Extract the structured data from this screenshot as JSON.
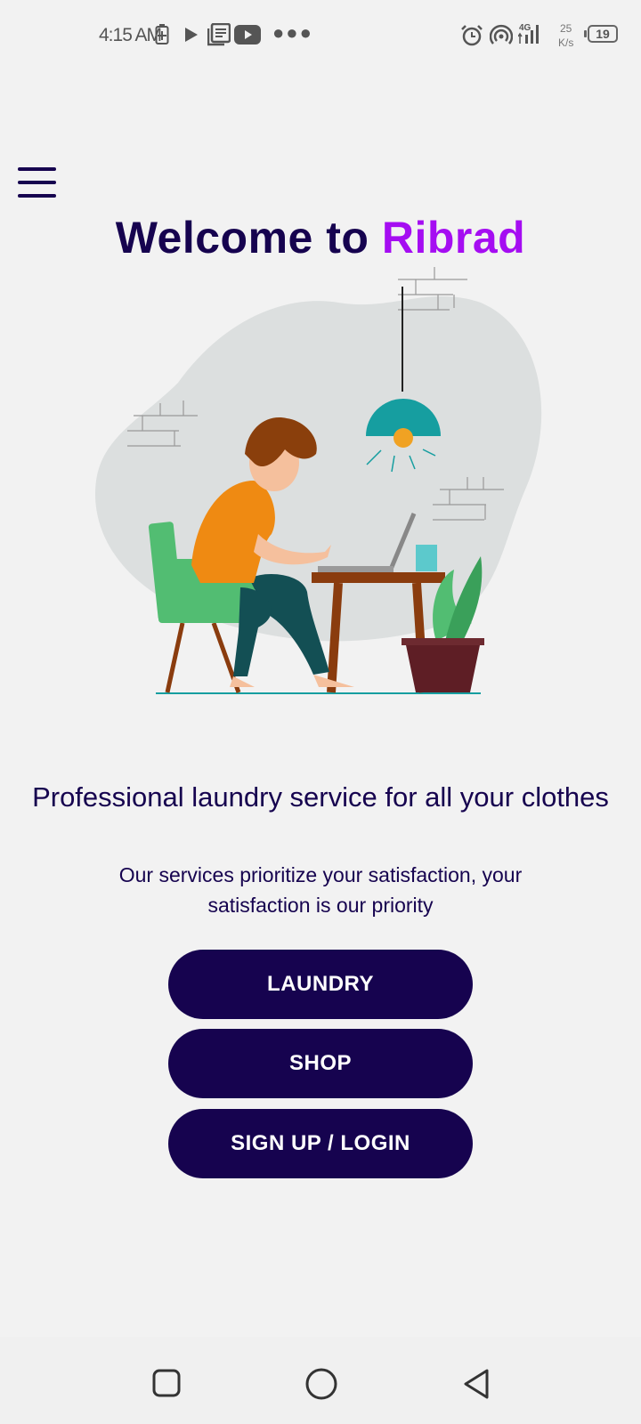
{
  "status_bar": {
    "time": "4:15 AM",
    "network": "4G",
    "speed_value": "25",
    "speed_unit": "K/s",
    "battery": "19"
  },
  "header": {
    "welcome_text": "Welcome to",
    "brand_name": "Ribrad",
    "brand_color": "#a50df2"
  },
  "hero": {
    "tagline": "Professional laundry service for all your clothes",
    "subtitle": "Our services prioritize your satisfaction, your satisfaction is our priority"
  },
  "actions": {
    "laundry_label": "LAUNDRY",
    "shop_label": "SHOP",
    "signup_label": "SIGN UP / LOGIN"
  },
  "theme": {
    "primary": "#16034f",
    "background": "#f2f2f2"
  },
  "icons": [
    "battery-saver-icon",
    "play-icon",
    "news-icon",
    "youtube-icon",
    "more-icon",
    "alarm-icon",
    "hotspot-icon",
    "signal-icon",
    "battery-icon",
    "menu-icon",
    "recent-apps-icon",
    "home-icon",
    "back-icon"
  ]
}
